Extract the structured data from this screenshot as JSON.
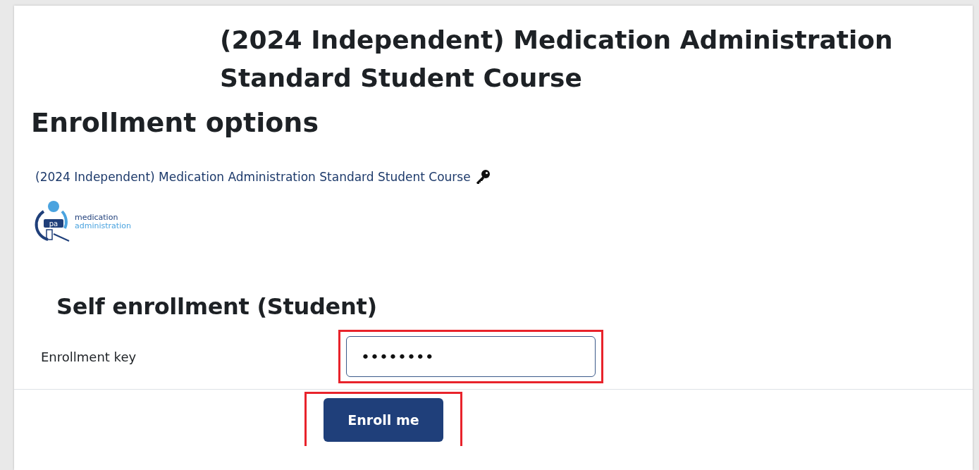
{
  "course_title": "(2024 Independent) Medication Administration Standard Student Course",
  "heading": "Enrollment options",
  "course_link": {
    "label": "(2024 Independent) Medication Administration Standard Student Course"
  },
  "logo": {
    "line_1": "medication",
    "line_2": "administration",
    "badge": "pa"
  },
  "self_enrollment": {
    "title": "Self enrollment (Student)",
    "field": {
      "label": "Enrollment key",
      "value": "••••••••",
      "highlighted": true
    },
    "button": {
      "label": "Enroll me",
      "highlighted": true
    }
  }
}
